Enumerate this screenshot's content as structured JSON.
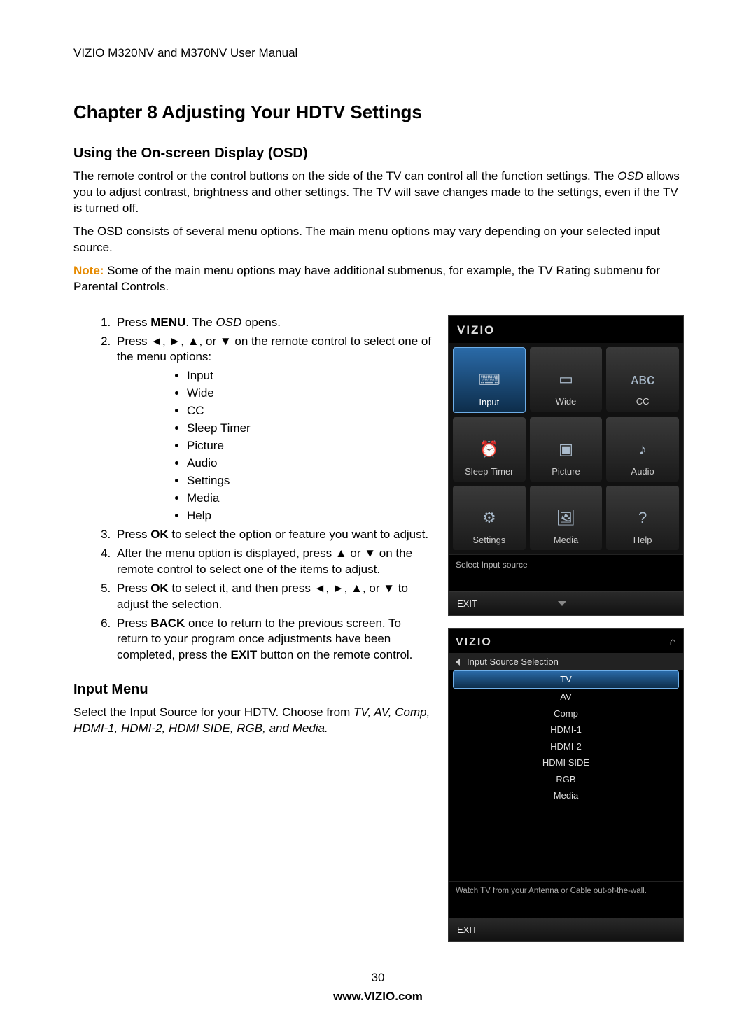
{
  "header": "VIZIO M320NV and M370NV User Manual",
  "chapter_title": "Chapter 8 Adjusting Your HDTV Settings",
  "section1": {
    "heading": "Using the On-screen Display (OSD",
    "p1a": "The remote control or the control buttons on the side of the TV can control all the function settings. The ",
    "p1b": "OSD",
    "p1c": " allows you to adjust contrast, brightness and other settings. The TV will save changes made to the settings, even if the TV is turned off.",
    "p2": "The OSD consists of several menu options. The main menu options may vary depending on your selected input source.",
    "note_label": "Note:",
    "note_text": "  Some of the main menu options may have additional submenus, for example, the TV Rating submenu for Parental Controls.",
    "step1a": "Press ",
    "step1b": "MENU",
    "step1c": ". The ",
    "step1d": "OSD",
    "step1e": " opens.",
    "step2": "Press ◄, ►, ▲, or ▼ on the remote control to select one of the menu options:",
    "bullets": [
      "Input",
      "Wide",
      "CC",
      "Sleep Timer",
      "Picture",
      "Audio",
      "Settings",
      "Media",
      "Help"
    ],
    "step3a": "Press ",
    "step3b": "OK",
    "step3c": " to select the option or feature you want to adjust.",
    "step4": "After the menu option is displayed, press ▲ or ▼ on the remote control to select one of the items to adjust.",
    "step5a": "Press ",
    "step5b": "OK",
    "step5c": " to select it, and then press ◄, ►, ▲, or ▼ to adjust the selection.",
    "step6a": "Press ",
    "step6b": "BACK",
    "step6c": " once to return to the previous screen. To return to your program once adjustments have been completed, press the ",
    "step6d": "EXIT",
    "step6e": " button on the remote control."
  },
  "section2": {
    "heading": "Input Menu",
    "p1a": "Select the Input Source for your HDTV. Choose from ",
    "p1b": "TV, AV, Comp, HDMI-1, HDMI-2, HDMI SIDE, RGB, and Media."
  },
  "osd": {
    "brand": "VIZIO",
    "cells": [
      {
        "label": "Input",
        "selected": true,
        "icon": "input-icon"
      },
      {
        "label": "Wide",
        "selected": false,
        "icon": "wide-icon"
      },
      {
        "label": "CC",
        "selected": false,
        "icon": "cc-icon"
      },
      {
        "label": "Sleep Timer",
        "selected": false,
        "icon": "clock-icon"
      },
      {
        "label": "Picture",
        "selected": false,
        "icon": "picture-icon"
      },
      {
        "label": "Audio",
        "selected": false,
        "icon": "audio-icon"
      },
      {
        "label": "Settings",
        "selected": false,
        "icon": "settings-icon"
      },
      {
        "label": "Media",
        "selected": false,
        "icon": "media-icon"
      },
      {
        "label": "Help",
        "selected": false,
        "icon": "help-icon"
      }
    ],
    "status": "Select Input source",
    "exit": "EXIT"
  },
  "input_menu": {
    "brand": "VIZIO",
    "title": "Input Source Selection",
    "items": [
      {
        "label": "TV",
        "selected": true
      },
      {
        "label": "AV",
        "selected": false
      },
      {
        "label": "Comp",
        "selected": false
      },
      {
        "label": "HDMI-1",
        "selected": false
      },
      {
        "label": "HDMI-2",
        "selected": false
      },
      {
        "label": "HDMI SIDE",
        "selected": false
      },
      {
        "label": "RGB",
        "selected": false
      },
      {
        "label": "Media",
        "selected": false
      }
    ],
    "desc": "Watch TV from your Antenna or Cable out-of-the-wall.",
    "exit": "EXIT"
  },
  "footer": {
    "page": "30",
    "url": "www.VIZIO.com"
  },
  "icons": {
    "input-icon": "⌨",
    "wide-icon": "▭",
    "cc-icon": "ᴀʙᴄ",
    "clock-icon": "⏰",
    "picture-icon": "▣",
    "audio-icon": "♪",
    "settings-icon": "⚙",
    "media-icon": "🖼",
    "help-icon": "?"
  }
}
